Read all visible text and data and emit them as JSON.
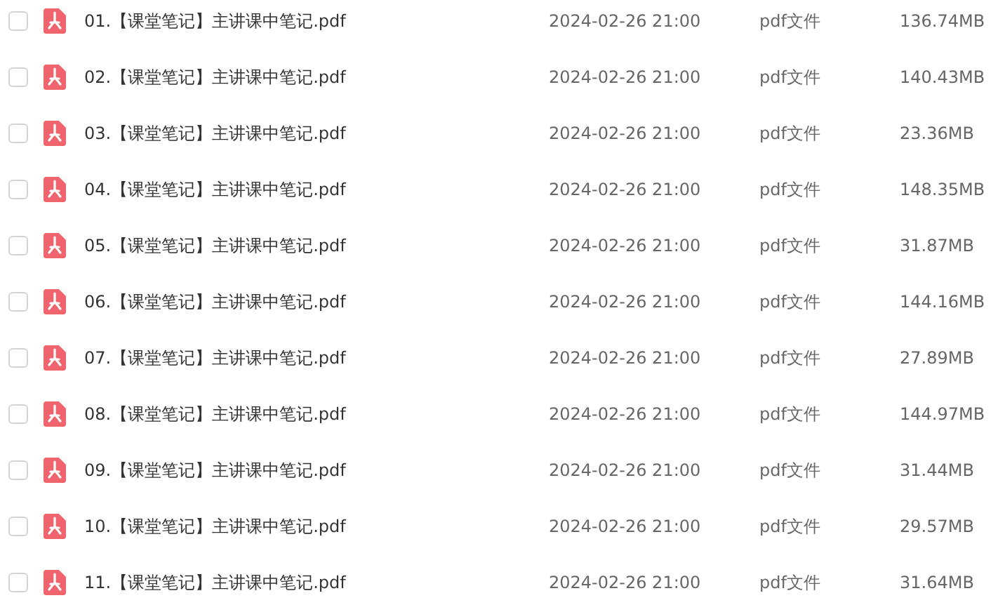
{
  "files": [
    {
      "name": "01.【课堂笔记】主讲课中笔记.pdf",
      "date": "2024-02-26 21:00",
      "type": "pdf文件",
      "size": "136.74MB",
      "checked": false
    },
    {
      "name": "02.【课堂笔记】主讲课中笔记.pdf",
      "date": "2024-02-26 21:00",
      "type": "pdf文件",
      "size": "140.43MB",
      "checked": false
    },
    {
      "name": "03.【课堂笔记】主讲课中笔记.pdf",
      "date": "2024-02-26 21:00",
      "type": "pdf文件",
      "size": "23.36MB",
      "checked": false
    },
    {
      "name": "04.【课堂笔记】主讲课中笔记.pdf",
      "date": "2024-02-26 21:00",
      "type": "pdf文件",
      "size": "148.35MB",
      "checked": false
    },
    {
      "name": "05.【课堂笔记】主讲课中笔记.pdf",
      "date": "2024-02-26 21:00",
      "type": "pdf文件",
      "size": "31.87MB",
      "checked": false
    },
    {
      "name": "06.【课堂笔记】主讲课中笔记.pdf",
      "date": "2024-02-26 21:00",
      "type": "pdf文件",
      "size": "144.16MB",
      "checked": false
    },
    {
      "name": "07.【课堂笔记】主讲课中笔记.pdf",
      "date": "2024-02-26 21:00",
      "type": "pdf文件",
      "size": "27.89MB",
      "checked": false
    },
    {
      "name": "08.【课堂笔记】主讲课中笔记.pdf",
      "date": "2024-02-26 21:00",
      "type": "pdf文件",
      "size": "144.97MB",
      "checked": false
    },
    {
      "name": "09.【课堂笔记】主讲课中笔记.pdf",
      "date": "2024-02-26 21:00",
      "type": "pdf文件",
      "size": "31.44MB",
      "checked": false
    },
    {
      "name": "10.【课堂笔记】主讲课中笔记.pdf",
      "date": "2024-02-26 21:00",
      "type": "pdf文件",
      "size": "29.57MB",
      "checked": false
    },
    {
      "name": "11.【课堂笔记】主讲课中笔记.pdf",
      "date": "2024-02-26 21:00",
      "type": "pdf文件",
      "size": "31.64MB",
      "checked": false
    }
  ]
}
